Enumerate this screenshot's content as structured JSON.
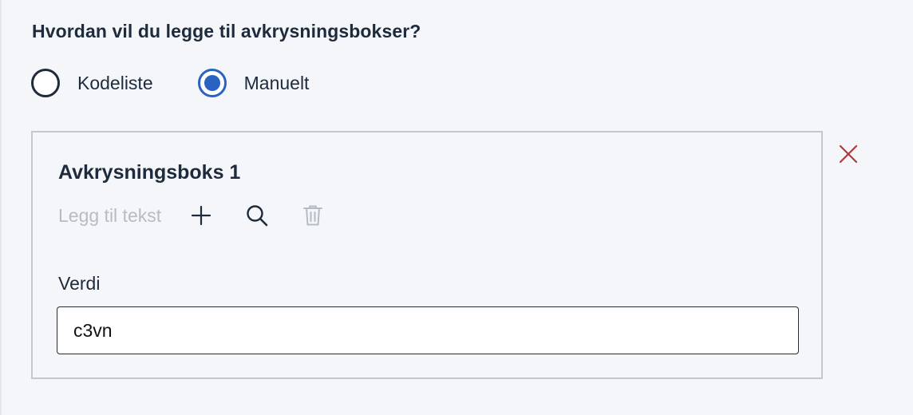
{
  "question": "Hvordan vil du legge til avkrysningsbokser?",
  "radio": {
    "options": [
      {
        "label": "Kodeliste",
        "checked": false
      },
      {
        "label": "Manuelt",
        "checked": true
      }
    ]
  },
  "card": {
    "title": "Avkrysningsboks 1",
    "add_text_label": "Legg til tekst",
    "icons": [
      "plus-icon",
      "search-icon",
      "trash-icon"
    ],
    "value_label": "Verdi",
    "value": "c3vn"
  },
  "close_icon": "close-icon",
  "colors": {
    "accent": "#2a62c2",
    "danger": "#b23a3a",
    "text": "#1e2b3c",
    "muted": "#b6bcc4",
    "background": "#f4f6f9"
  }
}
